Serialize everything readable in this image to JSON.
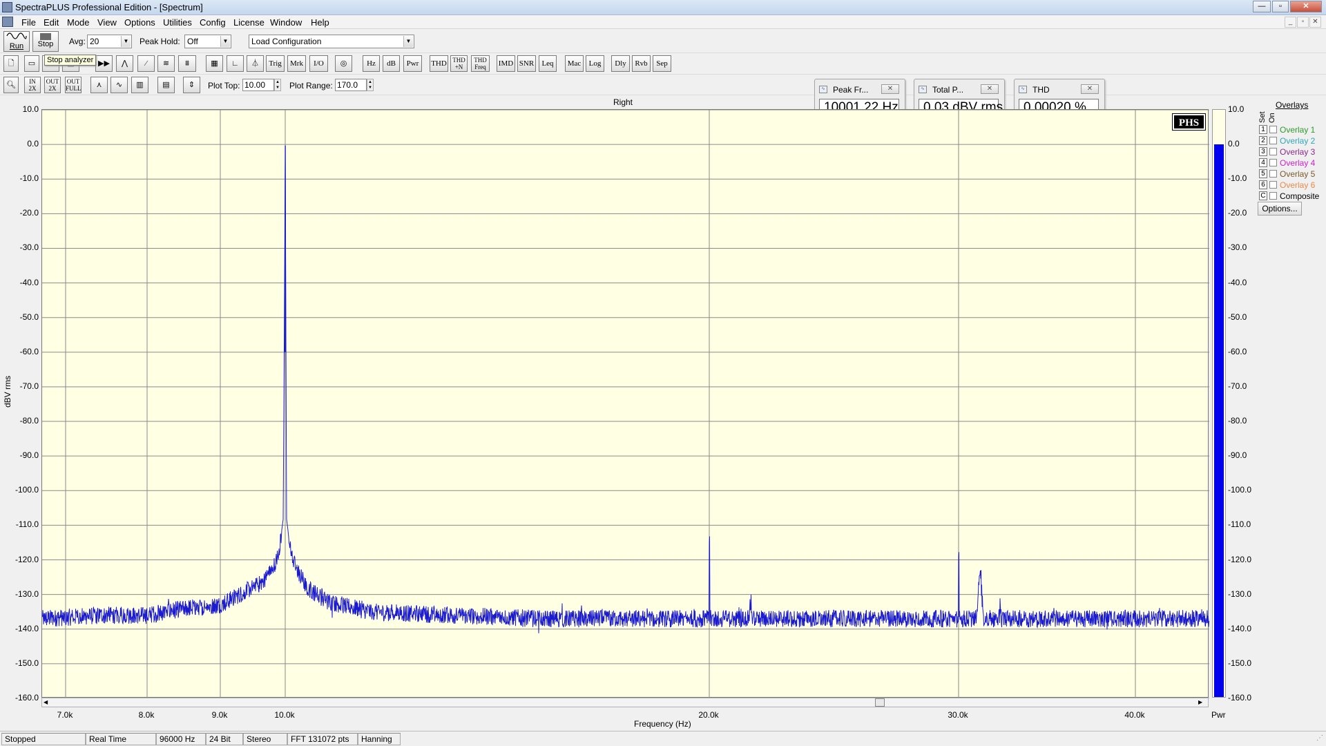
{
  "app": {
    "title": "SpectraPLUS Professional Edition - [Spectrum]"
  },
  "menu": [
    "File",
    "Edit",
    "Mode",
    "View",
    "Options",
    "Utilities",
    "Config",
    "License",
    "Window",
    "Help"
  ],
  "toolbar1": {
    "run_label": "Run",
    "stop_label": "Stop",
    "avg_label": "Avg:",
    "avg_value": "20",
    "peak_hold_label": "Peak Hold:",
    "peak_hold_value": "Off",
    "config_value": "Load Configuration"
  },
  "toolbar2": {
    "tooltip": "Stop analyzer",
    "buttons": [
      "Trig",
      "Mrk",
      "I/O",
      "Hz",
      "dB",
      "Pwr",
      "THD",
      "THD +N",
      "THD Freq",
      "IMD",
      "SNR",
      "Leq",
      "Mac",
      "Log",
      "Dly",
      "Rvb",
      "Sep"
    ]
  },
  "toolbar3": {
    "zoom_buttons": [
      "IN 2X",
      "OUT 2X",
      "OUT FULL"
    ],
    "plot_top_label": "Plot Top:",
    "plot_top_value": "10.00",
    "plot_range_label": "Plot Range:",
    "plot_range_value": "170.0"
  },
  "meters": [
    {
      "title": "Peak Fr...",
      "value": "10001.22 Hz"
    },
    {
      "title": "Total P...",
      "value": "0.03 dBV rms"
    },
    {
      "title": "THD",
      "value": "0.00020 %"
    }
  ],
  "chart_data": {
    "type": "line",
    "title": "Right",
    "xlabel": "Frequency (Hz)",
    "ylabel": "dBV rms",
    "xlim": [
      6700,
      43300
    ],
    "ylim": [
      -160,
      10
    ],
    "grid": true,
    "x_ticks": [
      "7.0k",
      "8.0k",
      "9.0k",
      "10.0k",
      "20.0k",
      "30.0k",
      "40.0k"
    ],
    "x_tick_values": [
      7000,
      8000,
      9000,
      10000,
      20000,
      30000,
      40000
    ],
    "y_ticks": [
      "10.0",
      "0.0",
      "-10.0",
      "-20.0",
      "-30.0",
      "-40.0",
      "-50.0",
      "-60.0",
      "-70.0",
      "-80.0",
      "-90.0",
      "-100.0",
      "-110.0",
      "-120.0",
      "-130.0",
      "-140.0",
      "-150.0",
      "-160.0"
    ],
    "noise_floor": -137,
    "series": [
      {
        "color": "#1a1ad0",
        "x": [
          6700,
          7500,
          8000,
          8500,
          9000,
          9300,
          9600,
          9800,
          9900,
          9970,
          10001,
          10030,
          10100,
          10200,
          10500,
          11000,
          12000,
          14000,
          16000,
          18000,
          19990,
          20000,
          20010,
          21600,
          21650,
          21700,
          26000,
          29990,
          30000,
          30010,
          31000,
          31100,
          31200,
          31300,
          31400,
          32300,
          32350,
          32400,
          36000,
          40000,
          43300
        ],
        "y": [
          -137,
          -136,
          -136,
          -134,
          -133,
          -130,
          -127,
          -123,
          -118,
          -108,
          -0.3,
          -108,
          -115,
          -121,
          -128,
          -132,
          -135,
          -136,
          -137,
          -137,
          -137,
          -115,
          -137,
          -137,
          -131,
          -137,
          -137,
          -137,
          -120,
          -137,
          -137,
          -129,
          -121,
          -129,
          -137,
          -137,
          -131,
          -137,
          -137,
          -137,
          -137
        ]
      }
    ],
    "meter": {
      "label": "Pwr",
      "level_dbv": 0.0,
      "ticks": [
        "10.0",
        "0.0",
        "-10.0",
        "-20.0",
        "-30.0",
        "-40.0",
        "-50.0",
        "-60.0",
        "-70.0",
        "-80.0",
        "-90.0",
        "-100.0",
        "-110.0",
        "-120.0",
        "-130.0",
        "-140.0",
        "-150.0",
        "-160.0"
      ]
    }
  },
  "overlays": {
    "title": "Overlays",
    "set_label": "Set",
    "on_label": "On",
    "items": [
      {
        "num": "1",
        "label": "Overlay 1",
        "color": "#2e9a2e"
      },
      {
        "num": "2",
        "label": "Overlay 2",
        "color": "#30a6b8"
      },
      {
        "num": "3",
        "label": "Overlay 3",
        "color": "#8a2a8a"
      },
      {
        "num": "4",
        "label": "Overlay 4",
        "color": "#d020d0"
      },
      {
        "num": "5",
        "label": "Overlay 5",
        "color": "#7a5a2a"
      },
      {
        "num": "6",
        "label": "Overlay 6",
        "color": "#e88a4a"
      },
      {
        "num": "C",
        "label": "Composite",
        "color": "#000000"
      }
    ],
    "options_label": "Options..."
  },
  "status": [
    "Stopped",
    "Real Time",
    "96000 Hz",
    "24 Bit",
    "Stereo",
    "FFT 131072 pts",
    "Hanning"
  ]
}
